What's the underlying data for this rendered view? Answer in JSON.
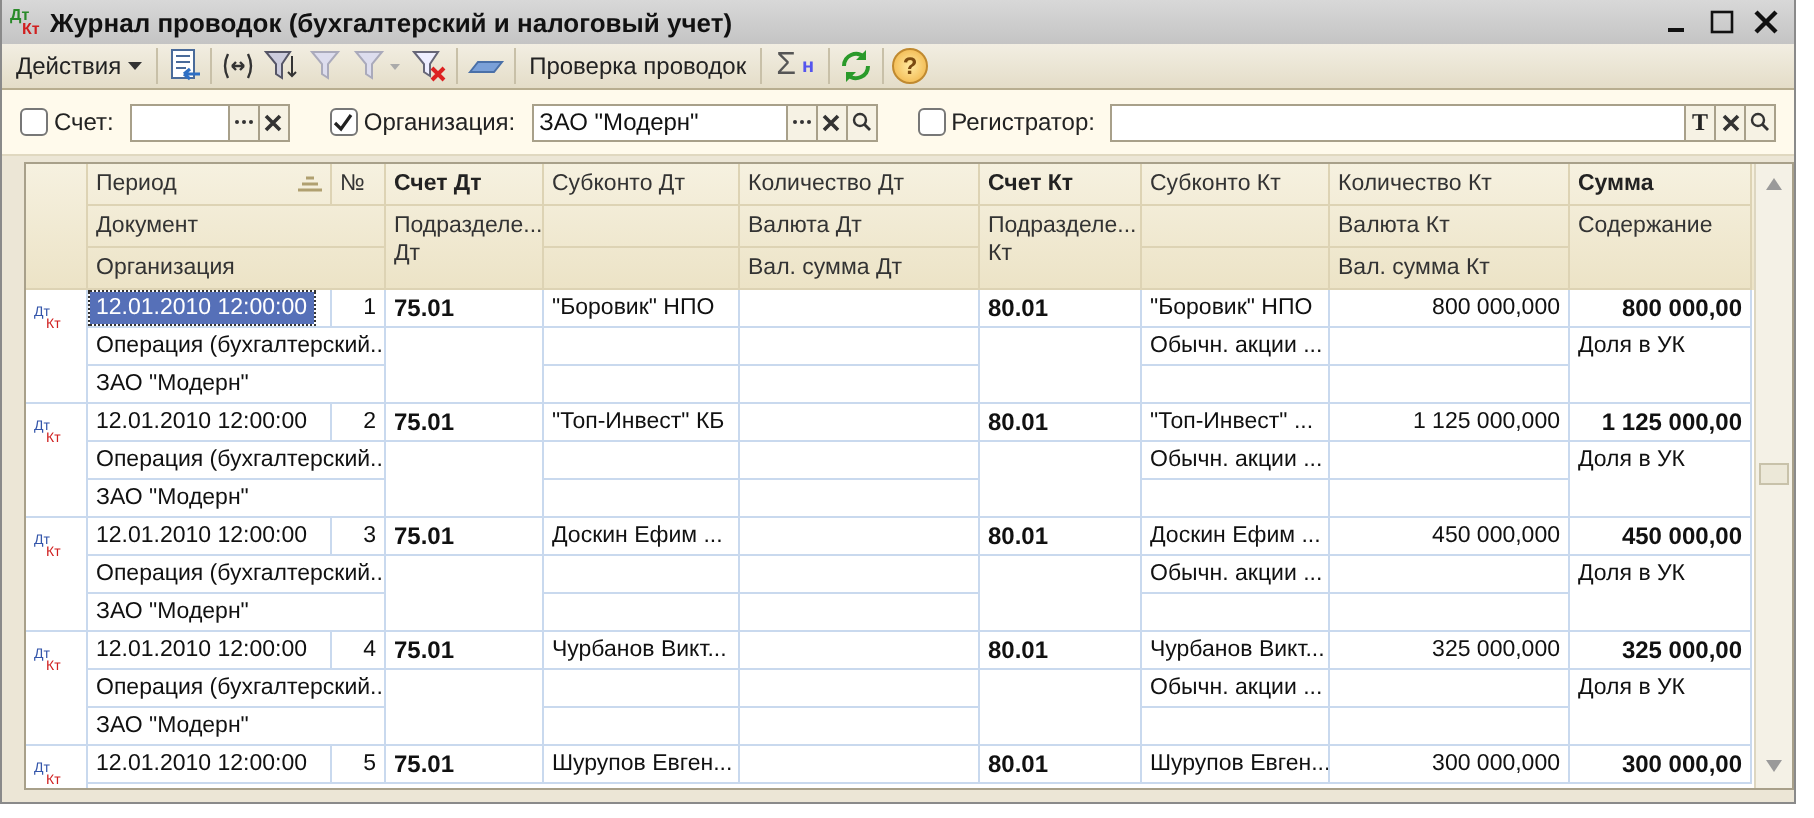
{
  "window": {
    "title": "Журнал проводок (бухгалтерский и налоговый учет)",
    "icon_dt": "Дт",
    "icon_kt": "Кт"
  },
  "toolbar": {
    "actions_menu": "Действия",
    "check_button": "Проверка проводок",
    "sigma_label": "Σ",
    "sigma_sub": "н",
    "help_label": "?"
  },
  "filters": [
    {
      "kind": "plain",
      "label": "Счет:",
      "checked": false
    },
    {
      "kind": "search",
      "label": "Организация:",
      "checked": true,
      "value": "ЗАО \"Модерн\""
    },
    {
      "kind": "text",
      "label": "Регистратор:",
      "checked": false,
      "type_button": "T"
    }
  ],
  "table": {
    "header": {
      "period": "Период",
      "num": "№",
      "account_dt": "Счет Дт",
      "subconto_dt": "Субконто Дт",
      "qty_dt": "Количество Дт",
      "account_kt": "Счет Кт",
      "subconto_kt": "Субконто Кт",
      "qty_kt": "Количество Кт",
      "sum": "Сумма",
      "document": "Документ",
      "division_dt": "Подразделе...\nДт",
      "currency_dt": "Валюта Дт",
      "division_kt": "Подразделе...\nКт",
      "currency_kt": "Валюта Кт",
      "content": "Содержание",
      "organization": "Организация",
      "cur_sum_dt": "Вал. сумма Дт",
      "cur_sum_kt": "Вал. сумма Кт"
    },
    "rows": [
      {
        "selected": true,
        "icon_dt": "Дт",
        "icon_kt": "Кт",
        "period": "12.01.2010 12:00:00",
        "num": "1",
        "account_dt": "75.01",
        "subconto_dt": "\"Боровик\" НПО",
        "account_kt": "80.01",
        "subconto_kt": "\"Боровик\" НПО",
        "qty_kt": "800 000,000",
        "sum": "800 000,00",
        "document": "Операция (бухгалтерский...",
        "subconto_kt_2": "Обычн. акции ...",
        "content": "Доля в УК",
        "organization": "ЗАО \"Модерн\""
      },
      {
        "selected": false,
        "icon_dt": "Дт",
        "icon_kt": "Кт",
        "period": "12.01.2010 12:00:00",
        "num": "2",
        "account_dt": "75.01",
        "subconto_dt": "\"Топ-Инвест\" КБ",
        "account_kt": "80.01",
        "subconto_kt": "\"Топ-Инвест\" ...",
        "qty_kt": "1 125 000,000",
        "sum": "1 125 000,00",
        "document": "Операция (бухгалтерский...",
        "subconto_kt_2": "Обычн. акции ...",
        "content": "Доля в УК",
        "organization": "ЗАО \"Модерн\""
      },
      {
        "selected": false,
        "icon_dt": "Дт",
        "icon_kt": "Кт",
        "period": "12.01.2010 12:00:00",
        "num": "3",
        "account_dt": "75.01",
        "subconto_dt": "Доскин Ефим ...",
        "account_kt": "80.01",
        "subconto_kt": "Доскин Ефим ...",
        "qty_kt": "450 000,000",
        "sum": "450 000,00",
        "document": "Операция (бухгалтерский...",
        "subconto_kt_2": "Обычн. акции ...",
        "content": "Доля в УК",
        "organization": "ЗАО \"Модерн\""
      },
      {
        "selected": false,
        "icon_dt": "Дт",
        "icon_kt": "Кт",
        "period": "12.01.2010 12:00:00",
        "num": "4",
        "account_dt": "75.01",
        "subconto_dt": "Чурбанов Викт...",
        "account_kt": "80.01",
        "subconto_kt": "Чурбанов Викт...",
        "qty_kt": "325 000,000",
        "sum": "325 000,00",
        "document": "Операция (бухгалтерский...",
        "subconto_kt_2": "Обычн. акции ...",
        "content": "Доля в УК",
        "organization": "ЗАО \"Модерн\""
      },
      {
        "selected": false,
        "icon_dt": "Дт",
        "icon_kt": "Кт",
        "period": "12.01.2010 12:00:00",
        "num": "5",
        "account_dt": "75.01",
        "subconto_dt": "Шурупов Евген...",
        "account_kt": "80.01",
        "subconto_kt": "Шурупов Евген...",
        "qty_kt": "300 000,000",
        "sum": "300 000,00"
      }
    ]
  }
}
